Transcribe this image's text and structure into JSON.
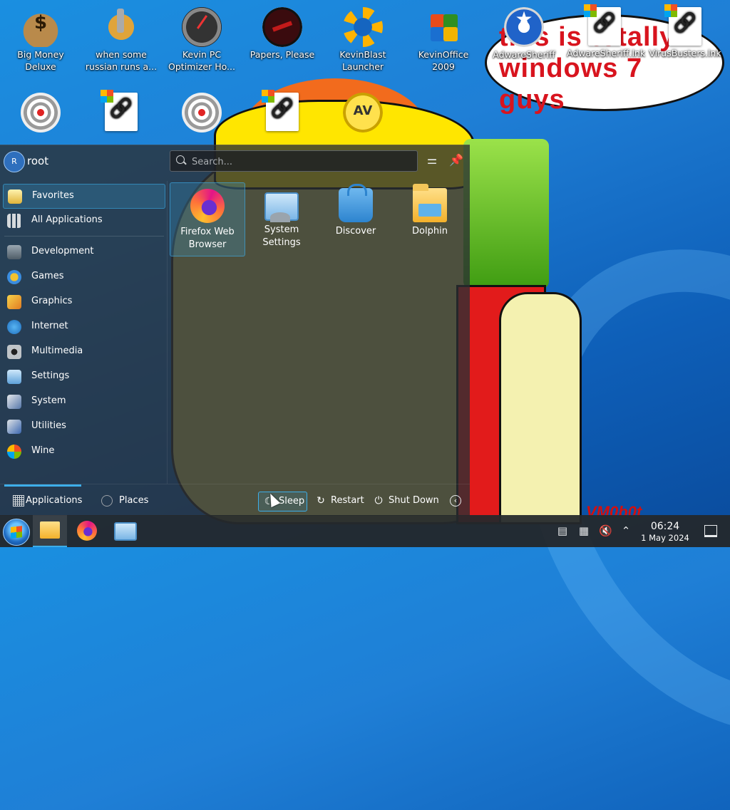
{
  "wallpaper": {
    "bubble_text": "this is totally windows 7 guys",
    "signature": "VM0b0t"
  },
  "desktop": {
    "icons": [
      {
        "label": "Big Money Deluxe",
        "icon": "money-bag-icon"
      },
      {
        "label": "when some russian runs a...",
        "icon": "gear-icon"
      },
      {
        "label": "Kevin PC Optimizer Ho...",
        "icon": "speed-gauge-icon"
      },
      {
        "label": "Papers, Please",
        "icon": "papers-please-icon"
      },
      {
        "label": "KevinBlast Launcher",
        "icon": "sun-globe-icon"
      },
      {
        "label": "KevinOffice 2009",
        "icon": "office-icon"
      },
      {
        "label": "AdwareSheriff",
        "icon": "sheriff-badge-icon"
      },
      {
        "label": "AdwareSheriff.lnk",
        "icon": "shortcut-link-icon"
      },
      {
        "label": "VirusBusters.lnk",
        "icon": "shortcut-link-icon"
      },
      {
        "label": "",
        "icon": "scanner-icon"
      },
      {
        "label": "",
        "icon": "shortcut-link-icon"
      },
      {
        "label": "",
        "icon": "scanner-icon"
      },
      {
        "label": "",
        "icon": "shortcut-link-icon"
      },
      {
        "label": "",
        "icon": "antivirus-icon"
      }
    ]
  },
  "launcher": {
    "user": {
      "name": "root",
      "avatar_initial": "R"
    },
    "search": {
      "placeholder": "Search...",
      "value": ""
    },
    "header_buttons": [
      {
        "name": "configure",
        "icon": "sliders-icon"
      },
      {
        "name": "pin",
        "icon": "pin-icon"
      }
    ],
    "categories": [
      {
        "label": "Favorites",
        "icon": "favorites-icon",
        "selected": true
      },
      {
        "label": "All Applications",
        "icon": "all-apps-icon",
        "selected": false
      },
      {
        "label": "Development",
        "icon": "development-icon",
        "selected": false
      },
      {
        "label": "Games",
        "icon": "games-icon",
        "selected": false
      },
      {
        "label": "Graphics",
        "icon": "graphics-icon",
        "selected": false
      },
      {
        "label": "Internet",
        "icon": "internet-icon",
        "selected": false
      },
      {
        "label": "Multimedia",
        "icon": "multimedia-icon",
        "selected": false
      },
      {
        "label": "Settings",
        "icon": "settings-icon",
        "selected": false
      },
      {
        "label": "System",
        "icon": "system-icon",
        "selected": false
      },
      {
        "label": "Utilities",
        "icon": "utilities-icon",
        "selected": false
      },
      {
        "label": "Wine",
        "icon": "wine-icon",
        "selected": false
      }
    ],
    "favorites": [
      {
        "label": "Firefox Web Browser",
        "icon": "firefox-icon",
        "selected": true
      },
      {
        "label": "System Settings",
        "icon": "system-settings-icon",
        "selected": false
      },
      {
        "label": "Discover",
        "icon": "discover-icon",
        "selected": false
      },
      {
        "label": "Dolphin",
        "icon": "dolphin-icon",
        "selected": false
      }
    ],
    "footer": {
      "tabs": [
        {
          "label": "Applications",
          "active": true
        },
        {
          "label": "Places",
          "active": false
        }
      ],
      "actions": [
        {
          "label": "Sleep",
          "icon": "sleep-icon"
        },
        {
          "label": "Restart",
          "icon": "restart-icon"
        },
        {
          "label": "Shut Down",
          "icon": "power-icon"
        }
      ],
      "more_icon": "chevron-left-icon"
    }
  },
  "taskbar": {
    "tasks": [
      {
        "name": "Dolphin",
        "icon": "folder-icon",
        "active": true
      },
      {
        "name": "Firefox",
        "icon": "firefox-icon",
        "active": false
      },
      {
        "name": "System Settings",
        "icon": "system-settings-icon",
        "active": false
      }
    ],
    "tray": [
      "clipboard-icon",
      "notes-icon",
      "volume-muted-icon",
      "chevron-up-icon"
    ],
    "clock": {
      "time": "06:24",
      "date": "1 May 2024"
    }
  },
  "colors": {
    "accent": "#3daee9",
    "panel": "#24282c"
  }
}
